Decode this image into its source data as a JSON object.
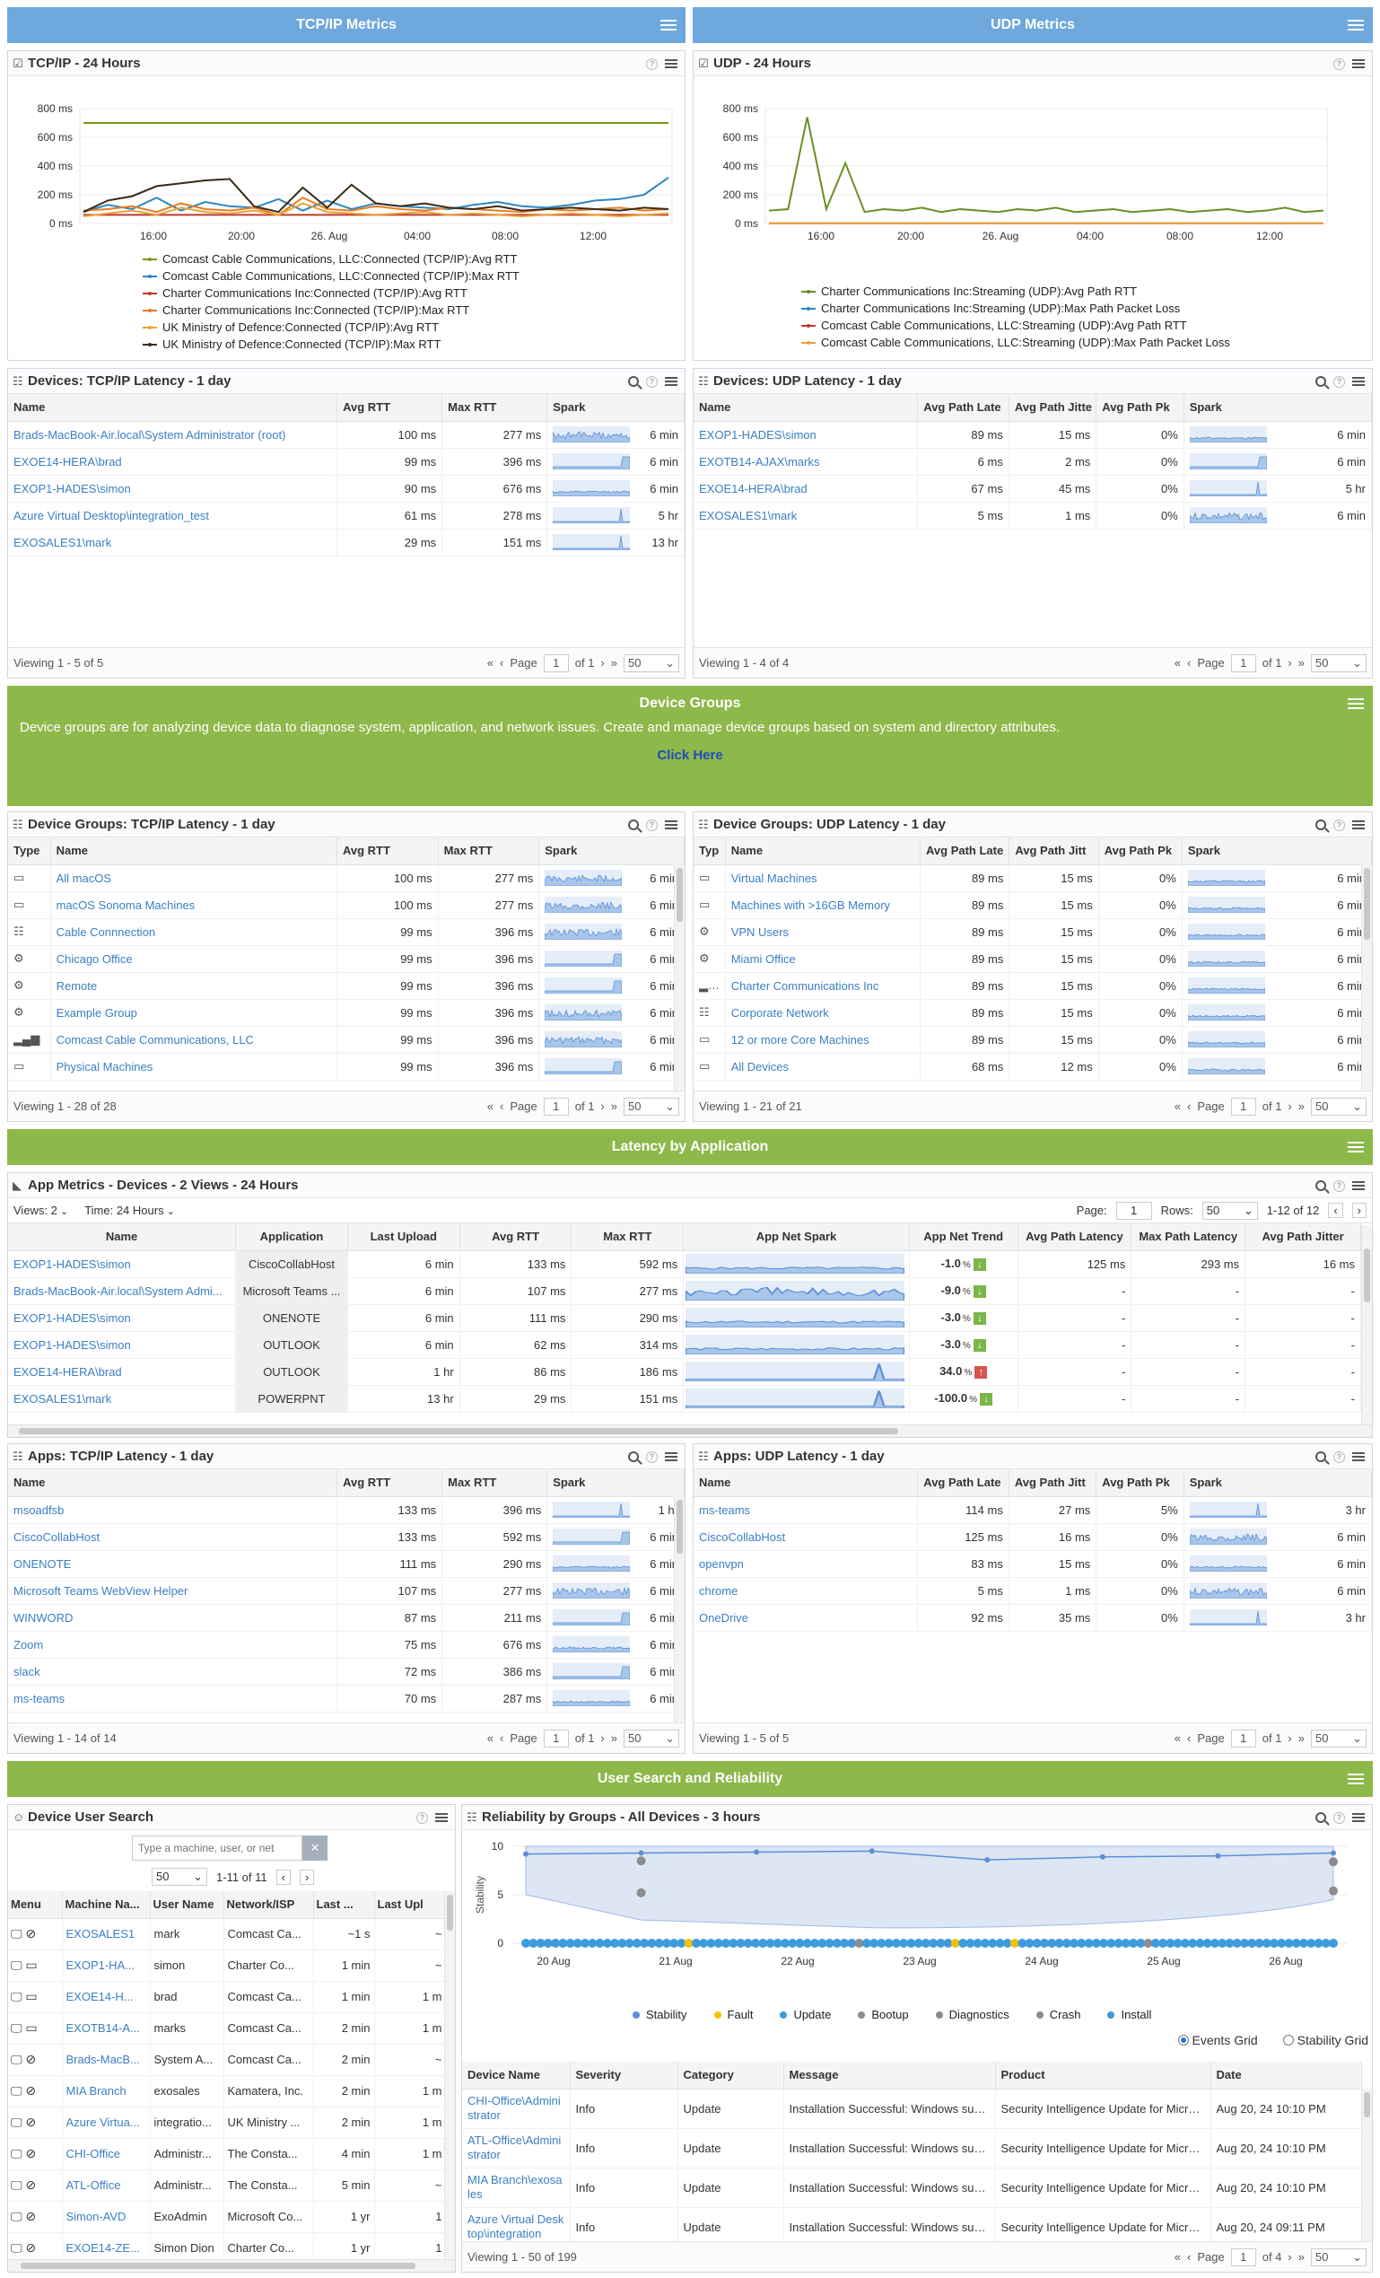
{
  "sections": {
    "tcp": "TCP/IP Metrics",
    "udp": "UDP Metrics",
    "groups": "Device Groups",
    "latency": "Latency by Application",
    "user": "User Search and Reliability"
  },
  "groups_banner": {
    "text": "Device groups are for analyzing device data to diagnose system, application, and network issues. Create and manage device groups based on system and directory attributes.",
    "link": "Click Here"
  },
  "colors": {
    "blue": "#6fa8dc",
    "green": "#8db84a",
    "link": "#3a7fc4"
  },
  "tcp_chart_panel": {
    "title": "TCP/IP - 24 Hours"
  },
  "udp_chart_panel": {
    "title": "UDP - 24 Hours"
  },
  "chart_data": [
    {
      "type": "line",
      "title": "TCP/IP - 24 Hours",
      "ylim": [
        0,
        800
      ],
      "yticks": [
        "800 ms",
        "600 ms",
        "400 ms",
        "200 ms",
        "0 ms"
      ],
      "xticks": [
        "16:00",
        "20:00",
        "26. Aug",
        "04:00",
        "08:00",
        "12:00"
      ],
      "series": [
        {
          "name": "Comcast Cable Communications, LLC:Connected (TCP/IP):Avg RTT",
          "color": "#7a9a1a",
          "values": [
            700,
            700,
            700,
            700,
            700,
            700,
            700,
            700,
            700,
            700,
            700,
            700,
            700,
            700,
            700,
            700,
            700,
            700,
            700,
            700,
            700,
            700,
            700,
            700,
            700
          ]
        },
        {
          "name": "Comcast Cable Communications, LLC:Connected (TCP/IP):Max RTT",
          "color": "#2e86c1",
          "values": [
            80,
            130,
            100,
            180,
            90,
            150,
            120,
            110,
            170,
            90,
            160,
            100,
            140,
            120,
            110,
            100,
            130,
            150,
            120,
            110,
            130,
            160,
            170,
            200,
            320
          ]
        },
        {
          "name": "Charter Communications Inc:Connected (TCP/IP):Avg RTT",
          "color": "#c0392b",
          "values": [
            60,
            60,
            60,
            60,
            60,
            60,
            60,
            60,
            60,
            60,
            60,
            60,
            60,
            60,
            60,
            60,
            60,
            60,
            60,
            60,
            60,
            60,
            60,
            60,
            60
          ]
        },
        {
          "name": "Charter Communications Inc:Connected (TCP/IP):Max RTT",
          "color": "#e67e22",
          "values": [
            90,
            100,
            120,
            80,
            140,
            100,
            90,
            110,
            60,
            180,
            100,
            90,
            120,
            100,
            90,
            110,
            100,
            90,
            80,
            100,
            90,
            100,
            110,
            90,
            100
          ]
        },
        {
          "name": "UK Ministry of Defence:Connected (TCP/IP):Avg RTT",
          "color": "#e8a33a",
          "values": [
            50,
            70,
            90,
            60,
            110,
            80,
            70,
            90,
            60,
            140,
            80,
            70,
            60,
            70,
            80,
            60,
            70,
            60,
            50,
            60,
            70,
            60,
            50,
            60,
            70
          ]
        },
        {
          "name": "UK Ministry of Defence:Connected (TCP/IP):Max RTT",
          "color": "#3b2a17",
          "values": [
            80,
            160,
            190,
            260,
            280,
            300,
            310,
            120,
            80,
            250,
            110,
            270,
            140,
            120,
            140,
            110,
            100,
            120,
            90,
            100,
            110,
            100,
            90,
            110,
            100
          ]
        }
      ]
    },
    {
      "type": "line",
      "title": "UDP - 24 Hours",
      "ylim": [
        0,
        800
      ],
      "yticks": [
        "800 ms",
        "600 ms",
        "400 ms",
        "200 ms",
        "0 ms"
      ],
      "xticks": [
        "16:00",
        "20:00",
        "26. Aug",
        "04:00",
        "08:00",
        "12:00"
      ],
      "series": [
        {
          "name": "Charter Communications Inc:Streaming (UDP):Avg Path RTT",
          "color": "#6b8e23",
          "values": [
            90,
            100,
            740,
            100,
            420,
            80,
            100,
            90,
            110,
            80,
            100,
            90,
            80,
            100,
            90,
            110,
            80,
            90,
            100,
            80,
            90,
            100,
            80,
            90,
            100,
            80,
            90,
            110,
            80,
            90
          ]
        },
        {
          "name": "Charter Communications Inc:Streaming (UDP):Max Path Packet Loss",
          "color": "#2e86c1",
          "values": [
            0,
            0,
            0,
            0,
            0,
            0,
            0,
            0,
            0,
            0,
            0,
            0,
            0,
            0,
            0,
            0,
            0,
            0,
            0,
            0,
            0,
            0,
            0,
            0,
            0,
            0,
            0,
            0,
            0,
            0
          ]
        },
        {
          "name": "Comcast Cable Communications, LLC:Streaming (UDP):Avg Path RTT",
          "color": "#c0392b",
          "values": [
            2,
            2,
            2,
            2,
            2,
            2,
            2,
            2,
            2,
            2,
            2,
            2,
            2,
            2,
            2,
            2,
            2,
            2,
            2,
            2,
            2,
            2,
            2,
            2,
            2,
            2,
            2,
            2,
            2,
            2
          ]
        },
        {
          "name": "Comcast Cable Communications, LLC:Streaming (UDP):Max Path Packet Loss",
          "color": "#e8a33a",
          "values": [
            0,
            0,
            0,
            0,
            0,
            0,
            0,
            0,
            0,
            0,
            0,
            0,
            0,
            0,
            0,
            0,
            0,
            0,
            0,
            0,
            0,
            0,
            0,
            0,
            0,
            0,
            0,
            0,
            0,
            0
          ]
        }
      ]
    }
  ],
  "dev_tcp": {
    "title": "Devices: TCP/IP Latency - 1 day",
    "columns": [
      "Name",
      "Avg RTT",
      "Max RTT",
      "Spark"
    ],
    "rows": [
      [
        "Brads-MacBook-Air.local\\System Administrator (root)",
        "100 ms",
        "277 ms",
        "6 min"
      ],
      [
        "EXOE14-HERA\\brad",
        "99 ms",
        "396 ms",
        "6 min"
      ],
      [
        "EXOP1-HADES\\simon",
        "90 ms",
        "676 ms",
        "6 min"
      ],
      [
        "Azure Virtual Desktop\\integration_test",
        "61 ms",
        "278 ms",
        "5 hr"
      ],
      [
        "EXOSALES1\\mark",
        "29 ms",
        "151 ms",
        "13 hr"
      ]
    ],
    "viewing": "Viewing 1 - 5 of 5",
    "page": "1",
    "of": "of 1",
    "size": "50"
  },
  "dev_udp": {
    "title": "Devices: UDP Latency - 1 day",
    "columns": [
      "Name",
      "Avg Path Late",
      "Avg Path Jitte",
      "Avg Path Pk",
      "Spark"
    ],
    "rows": [
      [
        "EXOP1-HADES\\simon",
        "89 ms",
        "15 ms",
        "0%",
        "6 min"
      ],
      [
        "EXOTB14-AJAX\\marks",
        "6 ms",
        "2 ms",
        "0%",
        "6 min"
      ],
      [
        "EXOE14-HERA\\brad",
        "67 ms",
        "45 ms",
        "0%",
        "5 hr"
      ],
      [
        "EXOSALES1\\mark",
        "5 ms",
        "1 ms",
        "0%",
        "6 min"
      ]
    ],
    "viewing": "Viewing 1 - 4 of 4",
    "page": "1",
    "of": "of 1",
    "size": "50"
  },
  "grp_tcp": {
    "title": "Device Groups: TCP/IP Latency - 1 day",
    "columns": [
      "Type",
      "Name",
      "Avg RTT",
      "Max RTT",
      "Spark"
    ],
    "rows": [
      [
        "laptop-icon",
        "All macOS",
        "100 ms",
        "277 ms",
        "6 min"
      ],
      [
        "laptop-icon",
        "macOS Sonoma Machines",
        "100 ms",
        "277 ms",
        "6 min"
      ],
      [
        "network-icon",
        "Cable Connnection",
        "99 ms",
        "396 ms",
        "6 min"
      ],
      [
        "cogs-icon",
        "Chicago Office",
        "99 ms",
        "396 ms",
        "6 min"
      ],
      [
        "cogs-icon",
        "Remote",
        "99 ms",
        "396 ms",
        "6 min"
      ],
      [
        "cogs-icon",
        "Example Group",
        "99 ms",
        "396 ms",
        "6 min"
      ],
      [
        "signal-icon",
        "Comcast Cable Communications, LLC",
        "99 ms",
        "396 ms",
        "6 min"
      ],
      [
        "laptop-icon",
        "Physical Machines",
        "99 ms",
        "396 ms",
        "6 min"
      ]
    ],
    "viewing": "Viewing 1 - 28 of 28",
    "page": "1",
    "of": "of 1",
    "size": "50"
  },
  "grp_udp": {
    "title": "Device Groups: UDP Latency - 1 day",
    "columns": [
      "Typ",
      "Name",
      "Avg Path Late",
      "Avg Path Jitt",
      "Avg Path Pk",
      "Spark"
    ],
    "rows": [
      [
        "laptop-icon",
        "Virtual Machines",
        "89 ms",
        "15 ms",
        "0%",
        "6 min"
      ],
      [
        "laptop-icon",
        "Machines with >16GB Memory",
        "89 ms",
        "15 ms",
        "0%",
        "6 min"
      ],
      [
        "cogs-icon",
        "VPN Users",
        "89 ms",
        "15 ms",
        "0%",
        "6 min"
      ],
      [
        "cogs-icon",
        "Miami Office",
        "89 ms",
        "15 ms",
        "0%",
        "6 min"
      ],
      [
        "signal-icon",
        "Charter Communications Inc",
        "89 ms",
        "15 ms",
        "0%",
        "6 min"
      ],
      [
        "network-icon",
        "Corporate Network",
        "89 ms",
        "15 ms",
        "0%",
        "6 min"
      ],
      [
        "laptop-icon",
        "12 or more Core Machines",
        "89 ms",
        "15 ms",
        "0%",
        "6 min"
      ],
      [
        "laptop-icon",
        "All Devices",
        "68 ms",
        "12 ms",
        "0%",
        "6 min"
      ]
    ],
    "viewing": "Viewing 1 - 21 of 21",
    "page": "1",
    "of": "of 1",
    "size": "50"
  },
  "app_metrics": {
    "title": "App Metrics - Devices - 2 Views - 24 Hours",
    "views_label": "Views: 2",
    "time_label": "Time: 24 Hours",
    "page_label": "Page:",
    "page_value": "1",
    "rows_label": "Rows:",
    "rows_value": "50",
    "range": "1-12 of 12",
    "columns": [
      "Name",
      "Application",
      "Last Upload",
      "Avg RTT",
      "Max RTT",
      "App Net Spark",
      "App Net Trend",
      "Avg Path Latency",
      "Max Path Latency",
      "Avg Path Jitter"
    ],
    "rows": [
      [
        "EXOP1-HADES\\simon",
        "CiscoCollabHost",
        "6 min",
        "133 ms",
        "592 ms",
        "-1.0",
        "down",
        "125 ms",
        "293 ms",
        "16 ms"
      ],
      [
        "Brads-MacBook-Air.local\\System Admi...",
        "Microsoft Teams ...",
        "6 min",
        "107 ms",
        "277 ms",
        "-9.0",
        "down",
        "-",
        "-",
        "-"
      ],
      [
        "EXOP1-HADES\\simon",
        "ONENOTE",
        "6 min",
        "111 ms",
        "290 ms",
        "-3.0",
        "down",
        "-",
        "-",
        "-"
      ],
      [
        "EXOP1-HADES\\simon",
        "OUTLOOK",
        "6 min",
        "62 ms",
        "314 ms",
        "-3.0",
        "down",
        "-",
        "-",
        "-"
      ],
      [
        "EXOE14-HERA\\brad",
        "OUTLOOK",
        "1 hr",
        "86 ms",
        "186 ms",
        "34.0",
        "up",
        "-",
        "-",
        "-"
      ],
      [
        "EXOSALES1\\mark",
        "POWERPNT",
        "13 hr",
        "29 ms",
        "151 ms",
        "-100.0",
        "down",
        "-",
        "-",
        "-"
      ]
    ],
    "pct": "%"
  },
  "app_tcp": {
    "title": "Apps: TCP/IP Latency - 1 day",
    "columns": [
      "Name",
      "Avg RTT",
      "Max RTT",
      "Spark"
    ],
    "rows": [
      [
        "msoadfsb",
        "133 ms",
        "396 ms",
        "1 hr"
      ],
      [
        "CiscoCollabHost",
        "133 ms",
        "592 ms",
        "6 min"
      ],
      [
        "ONENOTE",
        "111 ms",
        "290 ms",
        "6 min"
      ],
      [
        "Microsoft Teams WebView Helper",
        "107 ms",
        "277 ms",
        "6 min"
      ],
      [
        "WINWORD",
        "87 ms",
        "211 ms",
        "6 min"
      ],
      [
        "Zoom",
        "75 ms",
        "676 ms",
        "6 min"
      ],
      [
        "slack",
        "72 ms",
        "386 ms",
        "6 min"
      ],
      [
        "ms-teams",
        "70 ms",
        "287 ms",
        "6 min"
      ]
    ],
    "viewing": "Viewing 1 - 14 of 14",
    "page": "1",
    "of": "of 1",
    "size": "50"
  },
  "app_udp": {
    "title": "Apps: UDP Latency - 1 day",
    "columns": [
      "Name",
      "Avg Path Late",
      "Avg Path Jitt",
      "Avg Path Pk",
      "Spark"
    ],
    "rows": [
      [
        "ms-teams",
        "114 ms",
        "27 ms",
        "5%",
        "3 hr"
      ],
      [
        "CiscoCollabHost",
        "125 ms",
        "16 ms",
        "0%",
        "6 min"
      ],
      [
        "openvpn",
        "83 ms",
        "15 ms",
        "0%",
        "6 min"
      ],
      [
        "chrome",
        "5 ms",
        "1 ms",
        "0%",
        "6 min"
      ],
      [
        "OneDrive",
        "92 ms",
        "35 ms",
        "0%",
        "3 hr"
      ]
    ],
    "viewing": "Viewing 1 - 5 of 5",
    "page": "1",
    "of": "of 1",
    "size": "50"
  },
  "user_search": {
    "title": "Device User Search",
    "placeholder": "Type a machine, user, or net",
    "size": "50",
    "range": "1-11 of 11",
    "columns": [
      "Menu",
      "Machine Na...",
      "User Name",
      "Network/ISP",
      "Last ...",
      "Last Upl"
    ],
    "rows": [
      [
        "EXOSALES1",
        "mark",
        "Comcast Ca...",
        "~1 s",
        "~"
      ],
      [
        "EXOP1-HA...",
        "simon",
        "Charter Co...",
        "1 min",
        "~"
      ],
      [
        "EXOE14-H...",
        "brad",
        "Comcast Ca...",
        "1 min",
        "1 m"
      ],
      [
        "EXOTB14-A...",
        "marks",
        "Comcast Ca...",
        "2 min",
        "1 m"
      ],
      [
        "Brads-MacB...",
        "System A...",
        "Comcast Ca...",
        "2 min",
        "~"
      ],
      [
        "MIA Branch",
        "exosales",
        "Kamatera, Inc.",
        "2 min",
        "1 m"
      ],
      [
        "Azure Virtua...",
        "integratio...",
        "UK Ministry ...",
        "2 min",
        "1 m"
      ],
      [
        "CHI-Office",
        "Administr...",
        "The Consta...",
        "4 min",
        "1 m"
      ],
      [
        "ATL-Office",
        "Administr...",
        "The Consta...",
        "5 min",
        "~"
      ],
      [
        "Simon-AVD",
        "ExoAdmin",
        "Microsoft Co...",
        "1 yr",
        "1"
      ],
      [
        "EXOE14-ZE...",
        "Simon Dion",
        "Charter Co...",
        "1 yr",
        "1"
      ]
    ]
  },
  "reliability": {
    "title": "Reliability by Groups - All Devices - 3 hours",
    "ylabel": "Stability",
    "yticks": [
      "10",
      "5",
      "0"
    ],
    "xticks": [
      "20 Aug",
      "21 Aug",
      "22 Aug",
      "23 Aug",
      "24 Aug",
      "25 Aug",
      "26 Aug"
    ],
    "stability": [
      9.2,
      9.3,
      9.4,
      9.5,
      8.6,
      8.9,
      9.0,
      9.3
    ],
    "legend": [
      {
        "label": "Stability",
        "color": "#5b8fd4"
      },
      {
        "label": "Fault",
        "color": "#f2c200"
      },
      {
        "label": "Update",
        "color": "#3d9bdc"
      },
      {
        "label": "Bootup",
        "color": "#8c8c8c"
      },
      {
        "label": "Diagnostics",
        "color": "#8c8c8c"
      },
      {
        "label": "Crash",
        "color": "#8c8c8c"
      },
      {
        "label": "Install",
        "color": "#3d9bdc"
      }
    ],
    "radio_events": "Events Grid",
    "radio_stability": "Stability Grid",
    "columns": [
      "Device Name",
      "Severity",
      "Category",
      "Message",
      "Product",
      "Date"
    ],
    "rows": [
      [
        "CHI-Office\\Administrator",
        "Info",
        "Update",
        "Installation Successful: Windows succes",
        "Security Intelligence Update for Microso",
        "Aug 20, 24 10:10 PM"
      ],
      [
        "ATL-Office\\Administrator",
        "Info",
        "Update",
        "Installation Successful: Windows succes",
        "Security Intelligence Update for Microso",
        "Aug 20, 24 10:10 PM"
      ],
      [
        "MIA Branch\\exosales",
        "Info",
        "Update",
        "Installation Successful: Windows succes",
        "Security Intelligence Update for Microso",
        "Aug 20, 24 10:10 PM"
      ],
      [
        "Azure Virtual Desktop\\integration",
        "Info",
        "Update",
        "Installation Successful: Windows succes",
        "Security Intelligence Update for Microso",
        "Aug 20, 24 09:11 PM"
      ]
    ],
    "viewing": "Viewing 1 - 50 of 199",
    "page": "1",
    "of": "of 4",
    "size": "50"
  },
  "pager_text": {
    "page": "Page"
  }
}
